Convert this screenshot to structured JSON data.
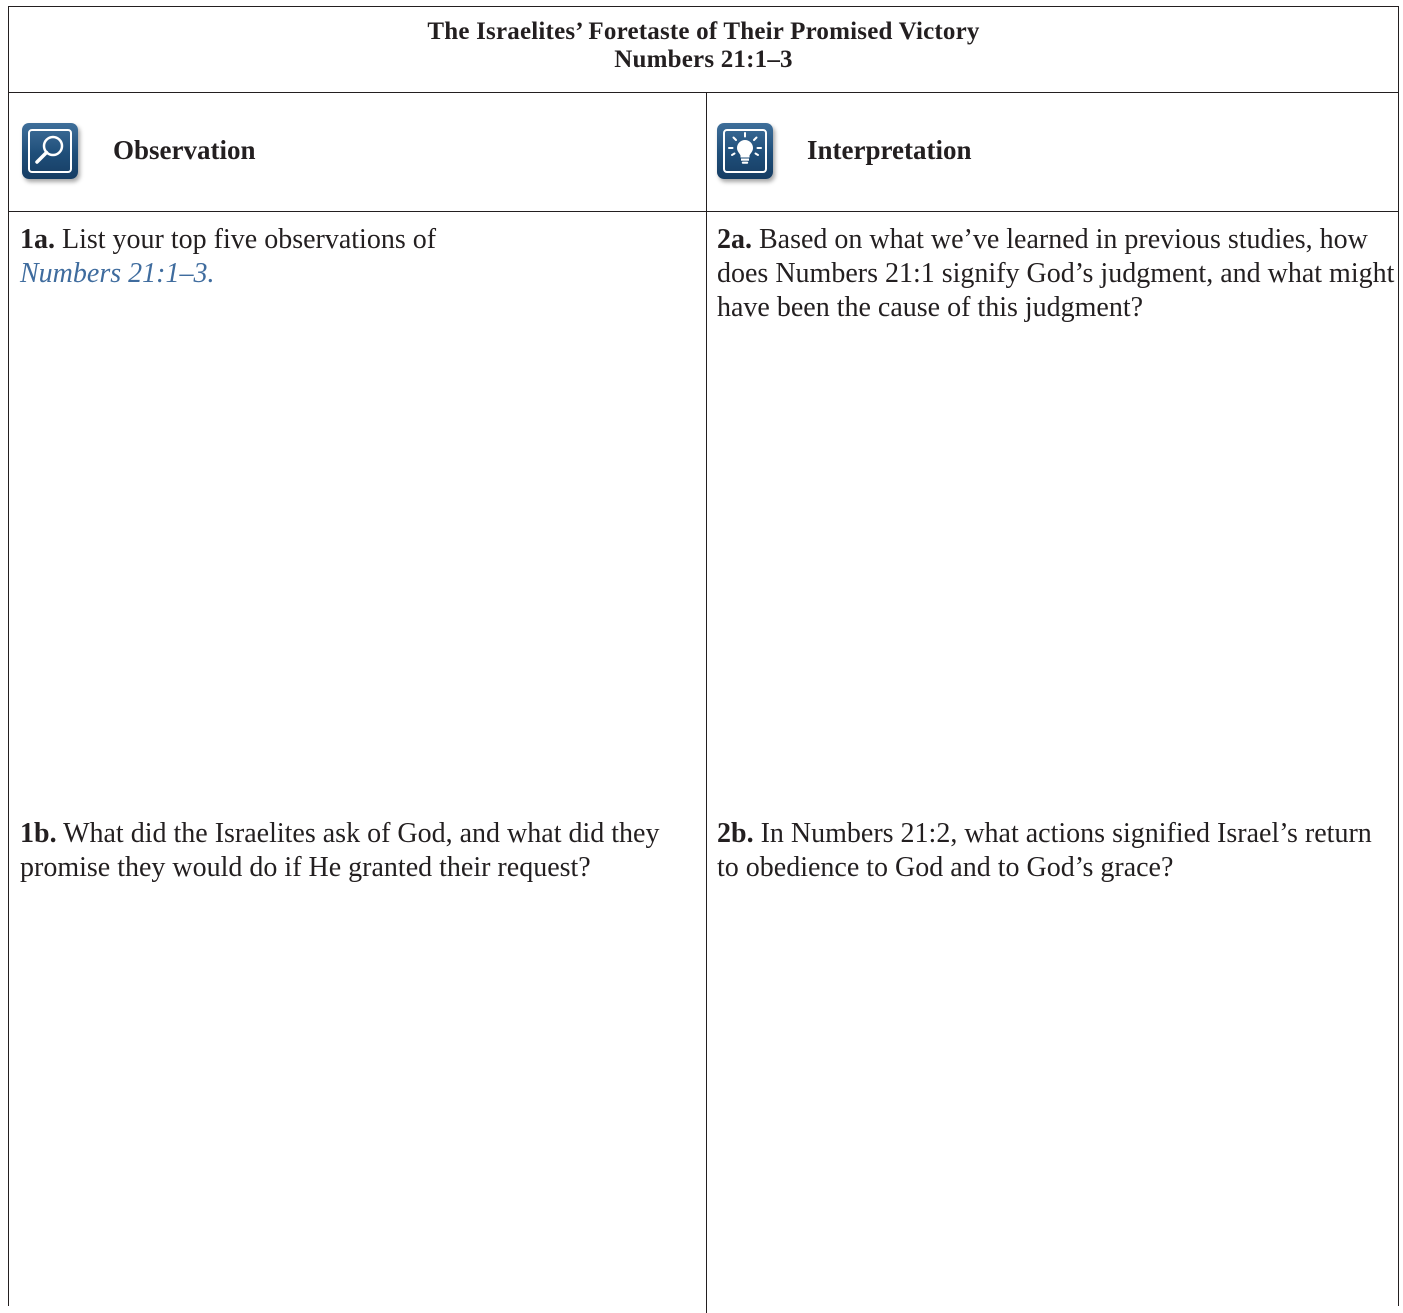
{
  "header": {
    "title": "The Israelites’ Foretaste of Their Promised Victory",
    "reference": "Numbers 21:1–3"
  },
  "columns": {
    "observation": {
      "label": "Observation",
      "icon": "magnifying-glass-icon"
    },
    "interpretation": {
      "label": "Interpretation",
      "icon": "lightbulb-icon"
    }
  },
  "questions": {
    "q1a": {
      "number": "1a.",
      "text": " List your top five observations of",
      "link": "Numbers 21:1–3",
      "after_link": "."
    },
    "q2a": {
      "number": "2a.",
      "text": " Based on what we’ve learned in previous studies, how does Numbers 21:1 signify God’s judgment, and what might have been the cause of this judgment?"
    },
    "q1b": {
      "number": "1b.",
      "text": " What did the Israelites ask of God, and what did they promise they would do if He granted their request?"
    },
    "q2b": {
      "number": "2b.",
      "text": " In Numbers 21:2, what actions signified Israel’s return to obedience to God and to God’s grace?"
    }
  },
  "colors": {
    "icon_blue": "#1f4e79",
    "link_blue": "#3f6c9e",
    "text": "#231f20"
  }
}
